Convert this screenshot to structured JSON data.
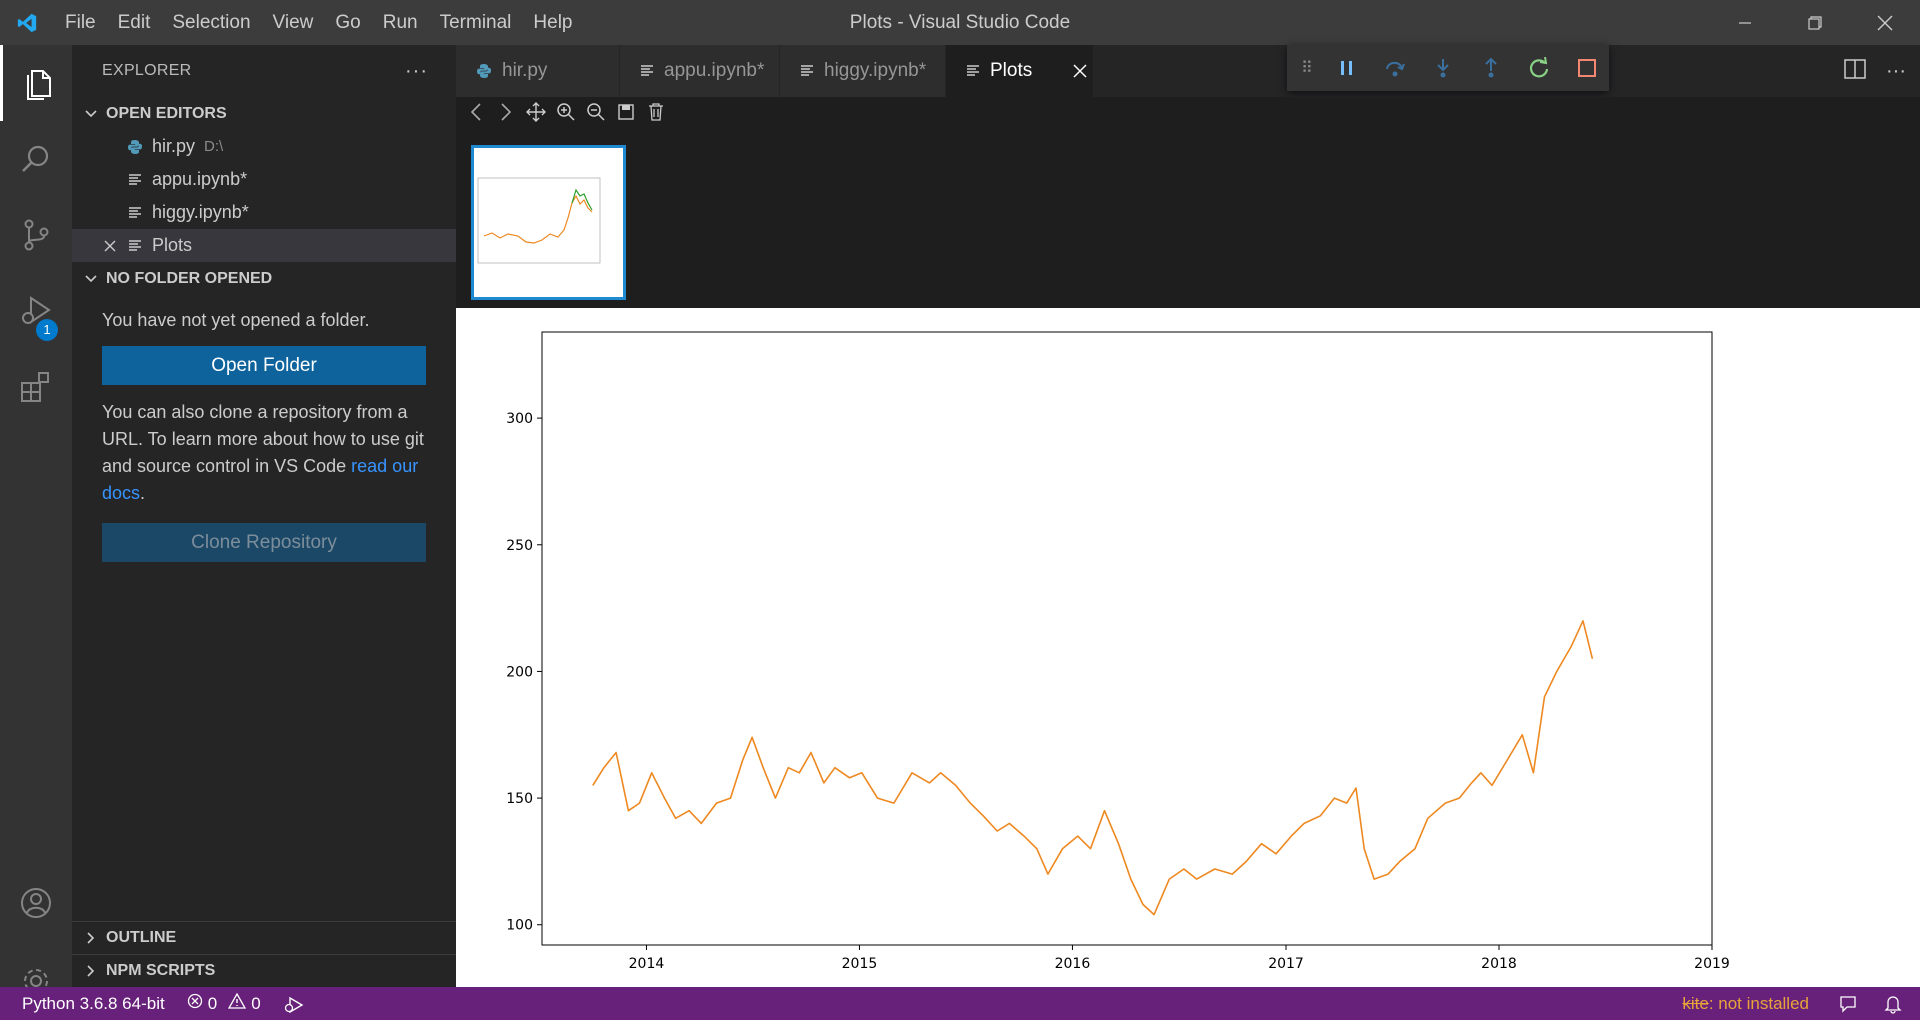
{
  "titlebar": {
    "window_title": "Plots - Visual Studio Code",
    "menu": [
      "File",
      "Edit",
      "Selection",
      "View",
      "Go",
      "Run",
      "Terminal",
      "Help"
    ]
  },
  "activity": {
    "debug_badge": "1"
  },
  "sidebar": {
    "title": "EXPLORER",
    "open_editors_label": "OPEN EDITORS",
    "open_editors": [
      {
        "name": "hir.py",
        "desc": "D:\\",
        "icon": "python-icon"
      },
      {
        "name": "appu.ipynb*",
        "desc": "",
        "icon": "notebook-icon"
      },
      {
        "name": "higgy.ipynb*",
        "desc": "",
        "icon": "notebook-icon"
      },
      {
        "name": "Plots",
        "desc": "",
        "icon": "notebook-icon",
        "selected": true
      }
    ],
    "no_folder_label": "NO FOLDER OPENED",
    "no_folder_text": "You have not yet opened a folder.",
    "open_folder_button": "Open Folder",
    "clone_text": "You can also clone a repository from a URL. To learn more about how to use git and source control in VS Code ",
    "docs_link": "read our docs",
    "clone_text_end": ".",
    "clone_button": "Clone Repository",
    "outline_label": "OUTLINE",
    "npm_label": "NPM SCRIPTS"
  },
  "tabs": [
    {
      "label": "hir.py",
      "icon": "python-icon"
    },
    {
      "label": "appu.ipynb*",
      "icon": "notebook-icon"
    },
    {
      "label": "higgy.ipynb*",
      "icon": "notebook-icon"
    },
    {
      "label": "Plots",
      "icon": "notebook-icon",
      "active": true
    }
  ],
  "colors": {
    "accent": "#007acc",
    "statusbar": "#68217a",
    "orange_series": "#ee8820",
    "green_series": "#2ca02c",
    "red_series": "#d62728"
  },
  "statusbar": {
    "python": "Python 3.6.8 64-bit",
    "errors": "0",
    "warnings": "0",
    "kite_name": "kite",
    "kite_status": ": not installed"
  },
  "chart_data": {
    "type": "line",
    "title": "",
    "xlabel": "",
    "ylabel": "",
    "x_ticks": [
      "2014",
      "2015",
      "2016",
      "2017",
      "2018",
      "2019"
    ],
    "y_ticks": [
      100,
      150,
      200,
      250,
      300
    ],
    "xlim": [
      "2013-07-06",
      "2019-01-01"
    ],
    "ylim": [
      92,
      334
    ],
    "grid": false,
    "series": [
      {
        "color": "#ee8820",
        "points": [
          [
            "2013-10-01",
            155
          ],
          [
            "2013-10-20",
            162
          ],
          [
            "2013-11-10",
            168
          ],
          [
            "2013-12-01",
            145
          ],
          [
            "2013-12-20",
            148
          ],
          [
            "2014-01-10",
            160
          ],
          [
            "2014-02-01",
            150
          ],
          [
            "2014-02-20",
            142
          ],
          [
            "2014-03-15",
            145
          ],
          [
            "2014-04-05",
            140
          ],
          [
            "2014-05-01",
            148
          ],
          [
            "2014-05-25",
            150
          ],
          [
            "2014-06-15",
            165
          ],
          [
            "2014-07-01",
            174
          ],
          [
            "2014-07-20",
            162
          ],
          [
            "2014-08-10",
            150
          ],
          [
            "2014-09-01",
            162
          ],
          [
            "2014-09-20",
            160
          ],
          [
            "2014-10-10",
            168
          ],
          [
            "2014-11-01",
            156
          ],
          [
            "2014-11-20",
            162
          ],
          [
            "2014-12-15",
            158
          ],
          [
            "2015-01-05",
            160
          ],
          [
            "2015-02-01",
            150
          ],
          [
            "2015-03-01",
            148
          ],
          [
            "2015-04-01",
            160
          ],
          [
            "2015-05-01",
            156
          ],
          [
            "2015-05-20",
            160
          ],
          [
            "2015-06-15",
            155
          ],
          [
            "2015-07-10",
            148
          ],
          [
            "2015-08-01",
            143
          ],
          [
            "2015-08-25",
            137
          ],
          [
            "2015-09-15",
            140
          ],
          [
            "2015-10-10",
            135
          ],
          [
            "2015-11-01",
            130
          ],
          [
            "2015-11-20",
            120
          ],
          [
            "2015-12-15",
            130
          ],
          [
            "2016-01-10",
            135
          ],
          [
            "2016-02-01",
            130
          ],
          [
            "2016-02-25",
            145
          ],
          [
            "2016-03-20",
            132
          ],
          [
            "2016-04-10",
            118
          ],
          [
            "2016-05-01",
            108
          ],
          [
            "2016-05-20",
            104
          ],
          [
            "2016-06-15",
            118
          ],
          [
            "2016-07-10",
            122
          ],
          [
            "2016-08-01",
            118
          ],
          [
            "2016-09-01",
            122
          ],
          [
            "2016-10-01",
            120
          ],
          [
            "2016-10-25",
            125
          ],
          [
            "2016-11-20",
            132
          ],
          [
            "2016-12-15",
            128
          ],
          [
            "2017-01-10",
            135
          ],
          [
            "2017-02-01",
            140
          ],
          [
            "2017-03-01",
            143
          ],
          [
            "2017-03-25",
            150
          ],
          [
            "2017-04-15",
            148
          ],
          [
            "2017-05-01",
            154
          ],
          [
            "2017-05-15",
            130
          ],
          [
            "2017-06-01",
            118
          ],
          [
            "2017-06-25",
            120
          ],
          [
            "2017-07-15",
            125
          ],
          [
            "2017-08-10",
            130
          ],
          [
            "2017-09-01",
            142
          ],
          [
            "2017-10-01",
            148
          ],
          [
            "2017-10-25",
            150
          ],
          [
            "2017-11-15",
            156
          ],
          [
            "2017-12-01",
            160
          ],
          [
            "2017-12-20",
            155
          ],
          [
            "2018-01-15",
            165
          ],
          [
            "2018-02-10",
            175
          ],
          [
            "2018-03-01",
            160
          ],
          [
            "2018-03-20",
            190
          ],
          [
            "2018-04-10",
            200
          ],
          [
            "2018-05-05",
            210
          ],
          [
            "2018-05-25",
            220
          ],
          [
            "2018-06-10",
            205
          ]
        ]
      }
    ]
  }
}
